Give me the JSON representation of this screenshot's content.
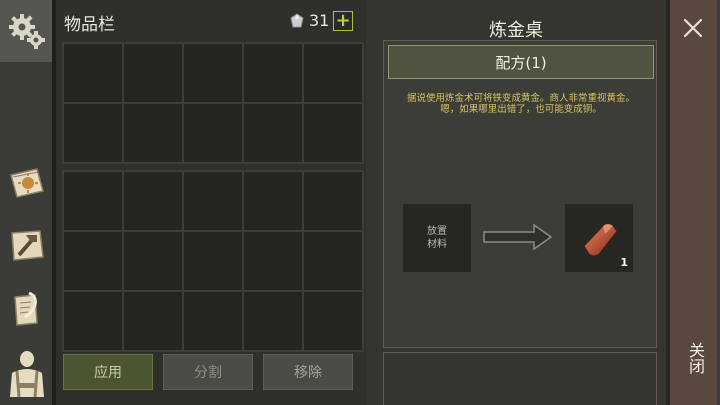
{
  "inventory": {
    "title": "物品栏",
    "currency_count": "31",
    "add_label": "+",
    "top_slots": 10,
    "bottom_slots": 15,
    "buttons": {
      "apply": "应用",
      "split": "分割",
      "remove": "移除"
    }
  },
  "alchemy": {
    "title": "炼金桌",
    "recipe_label": "配方(1)",
    "description": "据说使用炼金术可将铁变成黄金。商人非常重视黄金。嗯，如果哪里出错了，也可能变成铜。",
    "input_slot": {
      "line1": "放置",
      "line2": "材料"
    },
    "output_slot": {
      "quantity": "1",
      "item_icon": "copper-ingot-icon"
    }
  },
  "close": {
    "label": "关闭",
    "icon": "close-icon"
  },
  "sidebar": {
    "icons": [
      "settings-gears-icon",
      "crafting-book-icon",
      "hammer-map-icon",
      "scroll-quill-icon",
      "character-equipment-icon"
    ]
  },
  "colors": {
    "accent_green": "#a9c23a",
    "description_text": "#d7c25e",
    "copper": "#b6563a"
  }
}
